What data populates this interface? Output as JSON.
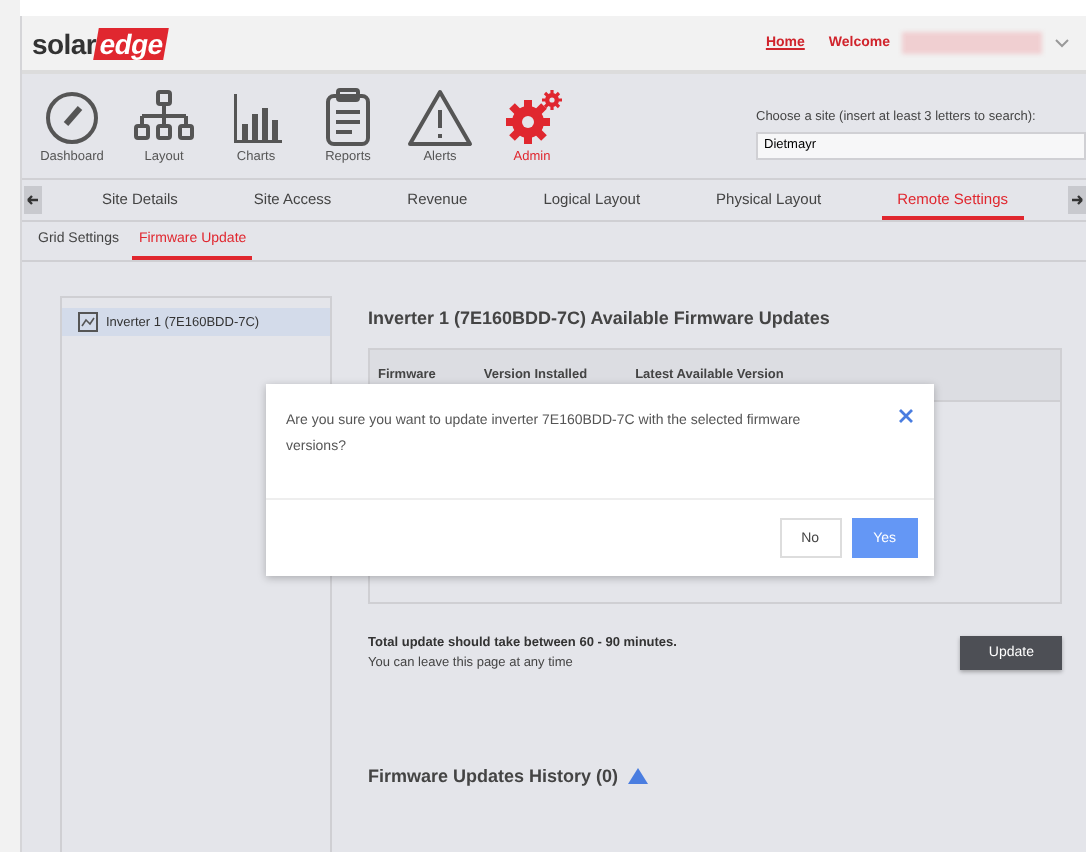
{
  "header": {
    "logo": {
      "dark": "solar",
      "accent": "edge"
    },
    "links": [
      {
        "label": "Home",
        "kind": "link"
      },
      {
        "label": "Welcome",
        "kind": "welcome"
      }
    ]
  },
  "toolbar": {
    "items": [
      {
        "label": "Dashboard",
        "kind": "gauge",
        "selected": false
      },
      {
        "label": "Layout",
        "kind": "tree",
        "selected": false
      },
      {
        "label": "Charts",
        "kind": "chart",
        "selected": false
      },
      {
        "label": "Reports",
        "kind": "clipboard",
        "selected": false
      },
      {
        "label": "Alerts",
        "kind": "alert",
        "selected": false
      },
      {
        "label": "Admin",
        "kind": "gear",
        "selected": true
      }
    ],
    "site_search": {
      "label": "Choose a site (insert at least 3 letters to search):",
      "value": "Dietmayr"
    }
  },
  "tabs": [
    {
      "label": "Site Details",
      "selected": false
    },
    {
      "label": "Site Access",
      "selected": false
    },
    {
      "label": "Revenue",
      "selected": false
    },
    {
      "label": "Logical Layout",
      "selected": false
    },
    {
      "label": "Physical Layout",
      "selected": false
    },
    {
      "label": "Remote Settings",
      "selected": true
    }
  ],
  "subtabs": [
    {
      "label": "Grid Settings",
      "selected": false
    },
    {
      "label": "Firmware Update",
      "selected": true
    }
  ],
  "inverters": [
    {
      "label": "Inverter 1 (7E160BDD-7C)",
      "selected": true
    }
  ],
  "panel": {
    "title": "Inverter 1 (7E160BDD-7C) Available Firmware Updates",
    "columns": [
      "Firmware",
      "Version Installed",
      "Latest Available Version"
    ],
    "note": "Total update should take between 60 - 90 minutes.",
    "subnote": "You can leave this page at any time",
    "button": "Update",
    "history_title": "Firmware Updates History (0)"
  },
  "dialog": {
    "message": "Are you sure you want to update inverter 7E160BDD-7C with the selected firmware versions?",
    "buttons": [
      {
        "label": "No",
        "kind": "secondary"
      },
      {
        "label": "Yes",
        "kind": "primary"
      }
    ]
  }
}
